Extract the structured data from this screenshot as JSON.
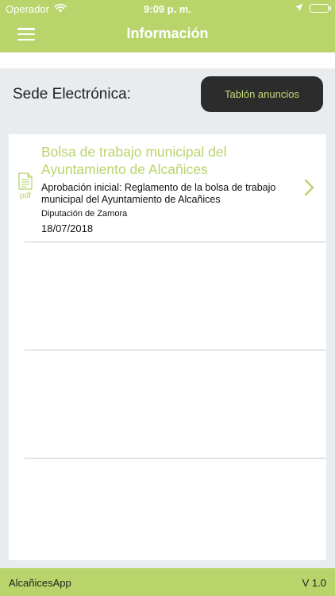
{
  "status_bar": {
    "carrier": "Operador",
    "time": "9:09 p. m.",
    "icons": [
      "wifi-icon",
      "location-arrow-icon",
      "battery-icon"
    ]
  },
  "header": {
    "title": "Información",
    "menu_icon": "hamburger-menu-icon"
  },
  "colors": {
    "accent": "#b9d46b",
    "dark_button": "#2c2c2c",
    "background": "#e9ecef"
  },
  "sede": {
    "label": "Sede Electrónica:",
    "button_label": "Tablón anuncios"
  },
  "items": [
    {
      "title": "Bolsa de trabajo municipal del Ayuntamiento de Alcañices",
      "description": "Aprobación inicial: Reglamento de la bolsa de trabajo municipal del Ayuntamiento de Alcañices",
      "source": "Diputación de Zamora",
      "date": "18/07/2018",
      "file_type": "pdf",
      "icon": "document-icon"
    }
  ],
  "footer": {
    "app_name": "AlcañicesApp",
    "version": "V 1.0"
  }
}
